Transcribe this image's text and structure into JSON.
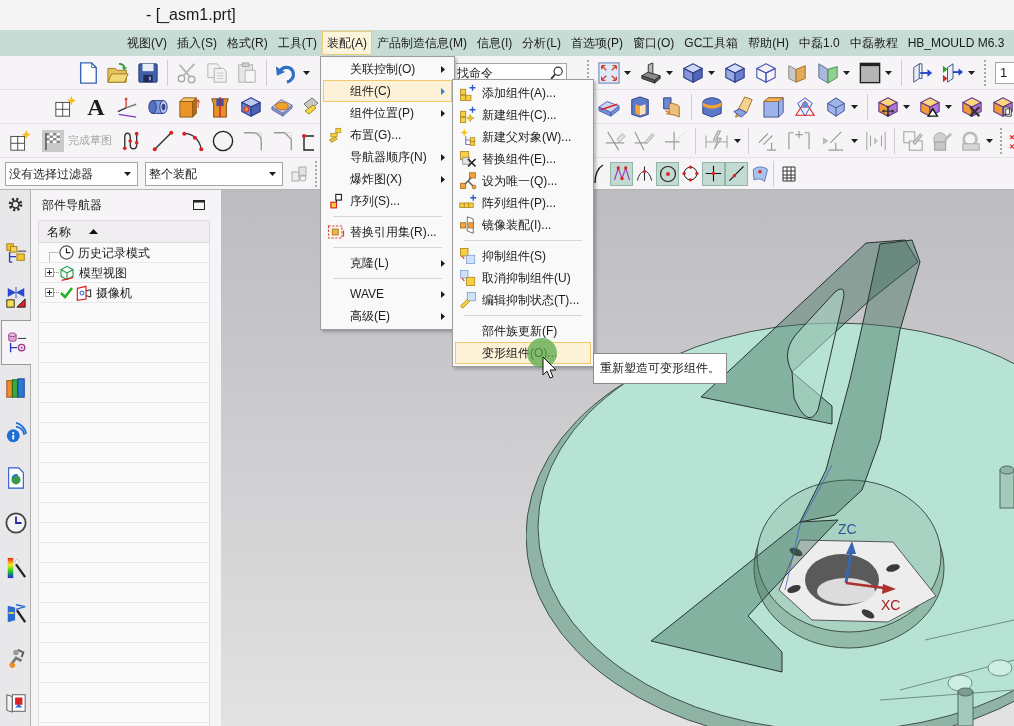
{
  "window": {
    "title": "- [_asm1.prt]"
  },
  "menu_bar": [
    {
      "label": "视图(V)",
      "selected": false
    },
    {
      "label": "插入(S)",
      "selected": false
    },
    {
      "label": "格式(R)",
      "selected": false
    },
    {
      "label": "工具(T)",
      "selected": false
    },
    {
      "label": "装配(A)",
      "selected": true
    },
    {
      "label": "产品制造信息(M)",
      "selected": false
    },
    {
      "label": "信息(I)",
      "selected": false
    },
    {
      "label": "分析(L)",
      "selected": false
    },
    {
      "label": "首选项(P)",
      "selected": false
    },
    {
      "label": "窗口(O)",
      "selected": false
    },
    {
      "label": "GC工具箱",
      "selected": false
    },
    {
      "label": "帮助(H)",
      "selected": false
    },
    {
      "label": "中磊1.0",
      "selected": false
    },
    {
      "label": "中磊教程",
      "selected": false
    },
    {
      "label": "HB_MOULD M6.3",
      "selected": false
    }
  ],
  "toolbars": {
    "command_search": {
      "placeholder": "找命令"
    },
    "work_layer": {
      "value": "1"
    },
    "text_tool": {
      "glyph": "A"
    },
    "finish_sketch": {
      "label": "完成草图",
      "disabled": true
    }
  },
  "selection_bar": {
    "type_filter": "没有选择过滤器",
    "scope": "整个装配",
    "snap_buttons": [
      {
        "kind": "arc",
        "pressed": false
      },
      {
        "kind": "control",
        "pressed": true
      },
      {
        "kind": "intersection",
        "pressed": false
      },
      {
        "kind": "center",
        "pressed": true
      },
      {
        "kind": "quadrant",
        "pressed": false
      },
      {
        "kind": "point",
        "pressed": true
      },
      {
        "kind": "oncurve",
        "pressed": true
      },
      {
        "kind": "onface",
        "pressed": false
      }
    ]
  },
  "resource_bar": {
    "tabs": [
      {
        "kind": "assembly",
        "selected": false
      },
      {
        "kind": "constraints",
        "selected": false
      },
      {
        "kind": "part",
        "selected": true
      },
      {
        "kind": "library",
        "selected": false
      },
      {
        "kind": "hd3d",
        "selected": false
      },
      {
        "kind": "web",
        "selected": false
      },
      {
        "kind": "history",
        "selected": false
      },
      {
        "kind": "materials",
        "selected": false
      },
      {
        "kind": "wizard",
        "selected": false
      },
      {
        "kind": "roles",
        "selected": false
      },
      {
        "kind": "palette",
        "selected": false
      }
    ]
  },
  "navigator": {
    "title": "部件导航器",
    "columns": [
      {
        "label": "名称",
        "sort_ascending": true
      }
    ],
    "rows": [
      {
        "kind": "history",
        "label": "历史记录模式",
        "checked": false
      },
      {
        "kind": "views",
        "label": "模型视图",
        "expanded": false,
        "checked": false
      },
      {
        "kind": "camera",
        "label": "摄像机",
        "expanded": false,
        "checked": true
      }
    ]
  },
  "assembly_menu": {
    "sections": [
      {
        "items": [
          {
            "label": "关联控制(O)",
            "submenu": true,
            "selected": false
          },
          {
            "label": "组件(C)",
            "submenu": true,
            "selected": true
          },
          {
            "label": "组件位置(P)",
            "submenu": true,
            "selected": false
          },
          {
            "label": "布置(G)...",
            "submenu": false,
            "selected": false
          },
          {
            "label": "导航器顺序(N)",
            "submenu": true,
            "selected": false
          },
          {
            "label": "爆炸图(X)",
            "submenu": true,
            "selected": false
          },
          {
            "label": "序列(S)...",
            "submenu": false,
            "selected": false
          }
        ]
      },
      {
        "items": [
          {
            "label": "替换引用集(R)...",
            "submenu": false,
            "selected": false
          }
        ]
      },
      {
        "items": [
          {
            "label": "克隆(L)",
            "submenu": true,
            "selected": false
          }
        ]
      },
      {
        "items": [
          {
            "label": "WAVE",
            "submenu": true,
            "selected": false
          },
          {
            "label": "高级(E)",
            "submenu": true,
            "selected": false
          }
        ]
      }
    ]
  },
  "component_submenu": {
    "sections": [
      {
        "items": [
          {
            "label": "添加组件(A)...",
            "selected": false
          },
          {
            "label": "新建组件(C)...",
            "selected": false
          },
          {
            "label": "新建父对象(W)...",
            "selected": false
          },
          {
            "label": "替换组件(E)...",
            "selected": false
          },
          {
            "label": "设为唯一(Q)...",
            "selected": false
          },
          {
            "label": "阵列组件(P)...",
            "selected": false
          },
          {
            "label": "镜像装配(I)...",
            "selected": false
          }
        ]
      },
      {
        "items": [
          {
            "label": "抑制组件(S)",
            "selected": false
          },
          {
            "label": "取消抑制组件(U)",
            "selected": false
          },
          {
            "label": "编辑抑制状态(T)...",
            "selected": false
          }
        ]
      },
      {
        "items": [
          {
            "label": "部件族更新(F)",
            "selected": false
          },
          {
            "label": "变形组件(O)...",
            "selected": true
          }
        ]
      }
    ]
  },
  "tooltip": {
    "text": "重新塑造可变形组件。"
  },
  "viewport": {
    "wcs": {
      "z_label": "ZC",
      "x_label": "XC"
    }
  }
}
